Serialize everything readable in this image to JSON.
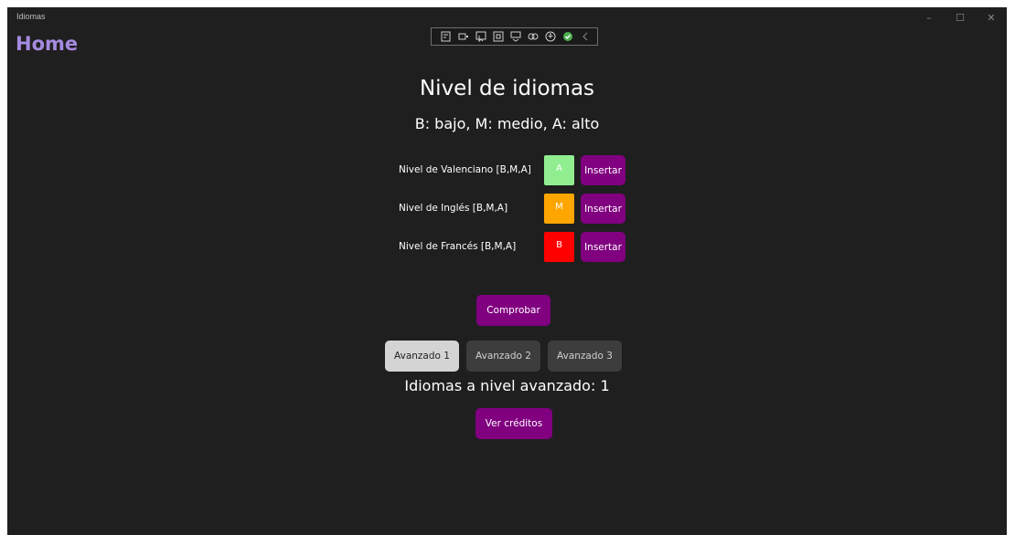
{
  "window": {
    "app_title": "Idiomas",
    "controls": {
      "minimize": "–",
      "maximize": "☐",
      "close": "✕"
    }
  },
  "nav": {
    "home_label": "Home"
  },
  "debug_toolbar": {
    "icons": [
      "live-visual-tree-icon",
      "select-element-icon",
      "display-layout-adorners-icon",
      "track-focus-icon",
      "hot-reload-icon",
      "binding-failures-icon",
      "accessibility-icon",
      "status-ok-icon",
      "collapse-chevron-icon"
    ],
    "status_color": "#4caf50"
  },
  "page": {
    "title": "Nivel de idiomas",
    "legend": "B: bajo, M: medio, A: alto"
  },
  "languages": [
    {
      "label": "Nivel de Valenciano [B,M,A]",
      "level": "A",
      "level_color": "#90ee90",
      "insert_label": "Insertar"
    },
    {
      "label": "Nivel de Inglés [B,M,A]",
      "level": "M",
      "level_color": "#ffa500",
      "insert_label": "Insertar"
    },
    {
      "label": "Nivel de Francés [B,M,A]",
      "level": "B",
      "level_color": "#ff0000",
      "insert_label": "Insertar"
    }
  ],
  "check_button": {
    "label": "Comprobar"
  },
  "advanced_options": [
    {
      "label": "Avanzado 1",
      "selected": true
    },
    {
      "label": "Avanzado 2",
      "selected": false
    },
    {
      "label": "Avanzado 3",
      "selected": false
    }
  ],
  "result_text": "Idiomas a nivel avanzado: 1",
  "credits_button": {
    "label": "Ver créditos"
  },
  "colors": {
    "accent": "#800080",
    "background": "#1f1f1f",
    "home": "#a58be0"
  }
}
